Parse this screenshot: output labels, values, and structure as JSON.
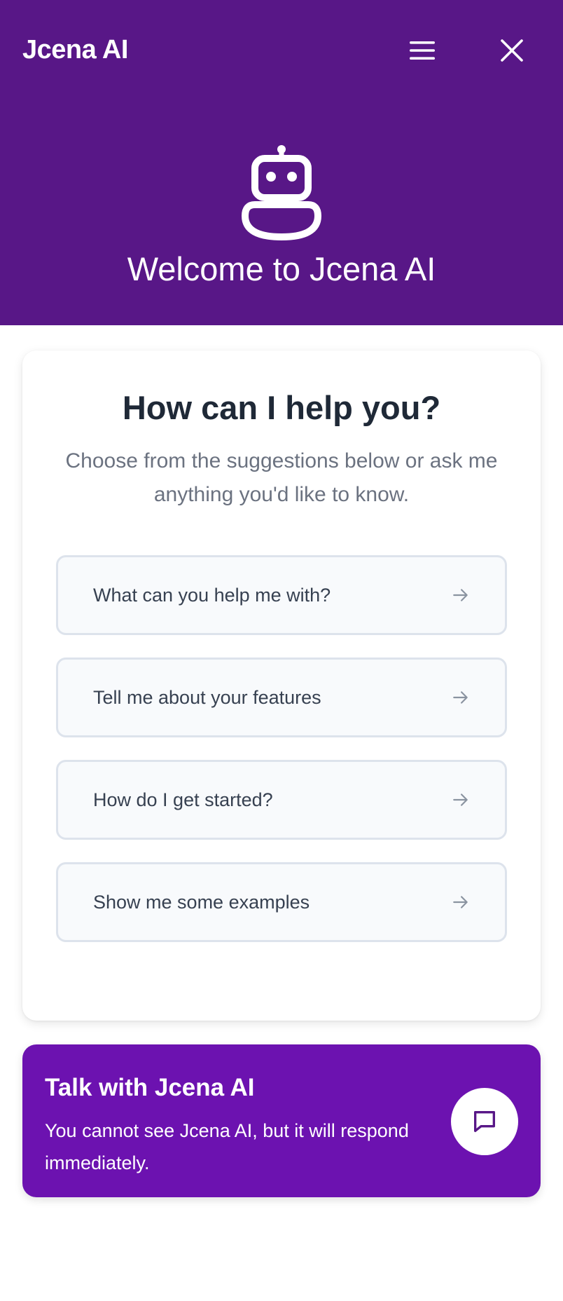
{
  "header": {
    "brand": "Jcena AI",
    "icons": {
      "menu": "hamburger-menu-icon",
      "close": "close-icon",
      "hero": "robot-icon"
    },
    "welcome": "Welcome to Jcena AI",
    "bg_color": "#581787"
  },
  "help": {
    "title": "How can I help you?",
    "subtitle": "Choose from the suggestions below or ask me anything you'd like to know.",
    "suggestions": [
      {
        "label": "What can you help me with?",
        "icon": "arrow-right-icon"
      },
      {
        "label": "Tell me about your features",
        "icon": "arrow-right-icon"
      },
      {
        "label": "How do I get started?",
        "icon": "arrow-right-icon"
      },
      {
        "label": "Show me some examples",
        "icon": "arrow-right-icon"
      }
    ]
  },
  "talk": {
    "title": "Talk with Jcena AI",
    "description": "You cannot see Jcena AI, but it will respond immediately.",
    "button_icon": "chat-bubble-icon",
    "bg_color": "#6c12b0"
  }
}
